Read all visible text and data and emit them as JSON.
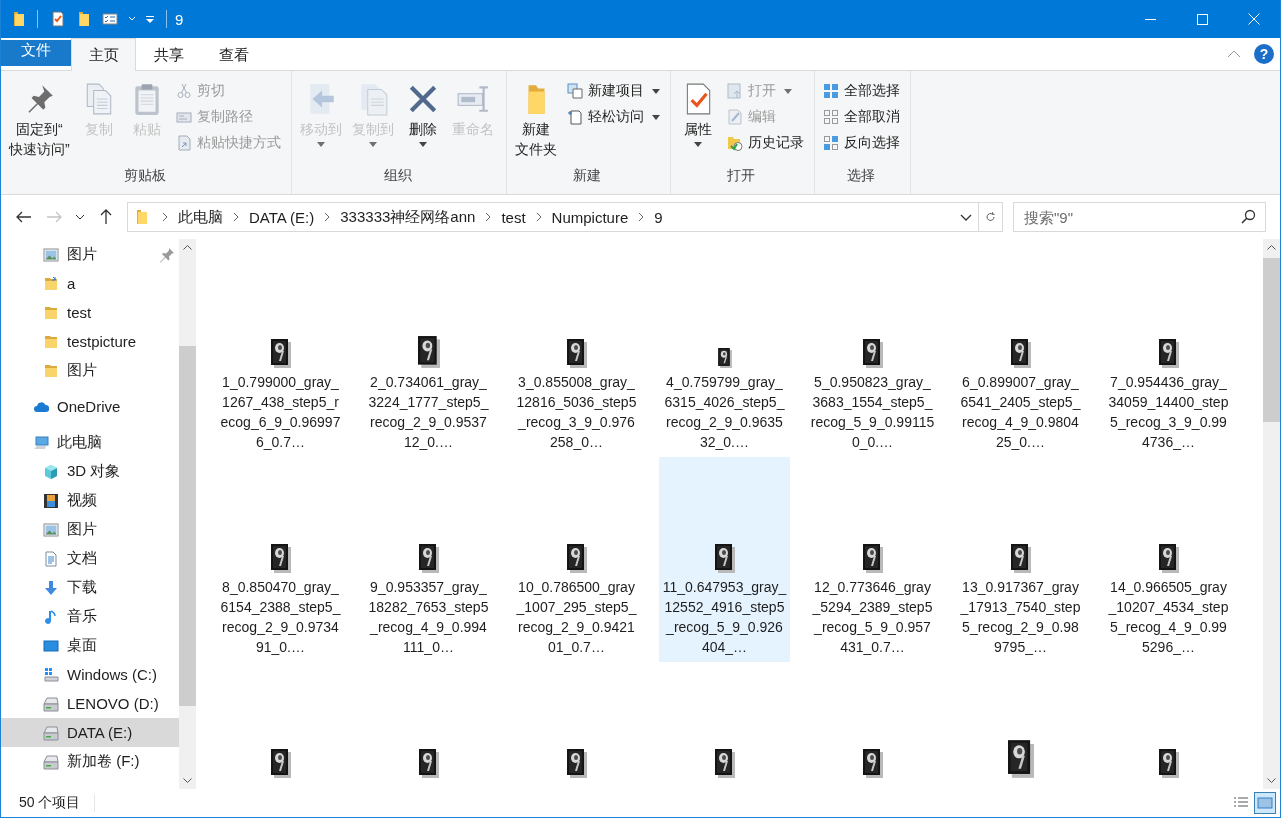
{
  "window": {
    "title": "9"
  },
  "ribbon_tabs": [
    {
      "label": "文件",
      "kind": "file",
      "selected": false
    },
    {
      "label": "主页",
      "kind": "tab",
      "selected": true
    },
    {
      "label": "共享",
      "kind": "tab",
      "selected": false
    },
    {
      "label": "查看",
      "kind": "tab",
      "selected": false
    }
  ],
  "help_button": {
    "label": "?"
  },
  "ribbon_groups": [
    {
      "title": "剪贴板",
      "items": [
        {
          "label_lines": [
            "固定到“",
            "快速访问”"
          ],
          "kind": "large",
          "disabled": false,
          "dropdown": false
        },
        {
          "label_lines": [
            "复制"
          ],
          "kind": "large",
          "disabled": true,
          "dropdown": false
        },
        {
          "label_lines": [
            "粘贴"
          ],
          "kind": "large",
          "disabled": true,
          "dropdown": false
        },
        {
          "label": "剪切",
          "kind": "small",
          "disabled": true,
          "dropdown": false
        },
        {
          "label": "复制路径",
          "kind": "small",
          "disabled": true,
          "dropdown": false
        },
        {
          "label": "粘贴快捷方式",
          "kind": "small",
          "disabled": true,
          "dropdown": false
        }
      ]
    },
    {
      "title": "组织",
      "items": [
        {
          "label_lines": [
            "移动到"
          ],
          "kind": "large",
          "disabled": true,
          "dropdown": true
        },
        {
          "label_lines": [
            "复制到"
          ],
          "kind": "large",
          "disabled": true,
          "dropdown": true
        },
        {
          "label_lines": [
            "删除"
          ],
          "kind": "large",
          "disabled": false,
          "dropdown": true
        },
        {
          "label_lines": [
            "重命名"
          ],
          "kind": "large",
          "disabled": true,
          "dropdown": false
        }
      ]
    },
    {
      "title": "新建",
      "items": [
        {
          "label_lines": [
            "新建",
            "文件夹"
          ],
          "kind": "large",
          "disabled": false,
          "dropdown": false
        },
        {
          "label": "新建项目",
          "kind": "small",
          "disabled": false,
          "dropdown": true
        },
        {
          "label": "轻松访问",
          "kind": "small",
          "disabled": false,
          "dropdown": true
        }
      ]
    },
    {
      "title": "打开",
      "items": [
        {
          "label_lines": [
            "属性"
          ],
          "kind": "large",
          "disabled": false,
          "dropdown": true
        },
        {
          "label": "打开",
          "kind": "small",
          "disabled": true,
          "dropdown": true
        },
        {
          "label": "编辑",
          "kind": "small",
          "disabled": true,
          "dropdown": false
        },
        {
          "label": "历史记录",
          "kind": "small",
          "disabled": false,
          "dropdown": false
        }
      ]
    },
    {
      "title": "选择",
      "items": [
        {
          "label": "全部选择",
          "kind": "small",
          "disabled": false,
          "dropdown": false
        },
        {
          "label": "全部取消",
          "kind": "small",
          "disabled": false,
          "dropdown": false
        },
        {
          "label": "反向选择",
          "kind": "small",
          "disabled": false,
          "dropdown": false
        }
      ]
    }
  ],
  "address_bar": {
    "forward_disabled": true,
    "segments": [
      "此电脑",
      "DATA (E:)",
      "333333神经网络ann",
      "test",
      "Numpicture",
      "9"
    ]
  },
  "search": {
    "placeholder": "搜索\"9\""
  },
  "sidebar": {
    "quick_access": [
      {
        "label": "图片",
        "pinned": true,
        "selected": false
      },
      {
        "label": "a",
        "pinned": false,
        "selected": false
      },
      {
        "label": "test",
        "pinned": false,
        "selected": false
      },
      {
        "label": "testpicture",
        "pinned": false,
        "selected": false
      },
      {
        "label": "图片",
        "pinned": false,
        "selected": false
      }
    ],
    "items": [
      {
        "label": "OneDrive",
        "selected": false
      },
      {
        "label": "此电脑",
        "selected": false,
        "children": [
          {
            "label": "3D 对象",
            "selected": false
          },
          {
            "label": "视频",
            "selected": false
          },
          {
            "label": "图片",
            "selected": false
          },
          {
            "label": "文档",
            "selected": false
          },
          {
            "label": "下载",
            "selected": false
          },
          {
            "label": "音乐",
            "selected": false
          },
          {
            "label": "桌面",
            "selected": false
          },
          {
            "label": "Windows (C:)",
            "selected": false
          },
          {
            "label": "LENOVO (D:)",
            "selected": false
          },
          {
            "label": "DATA (E:)",
            "selected": true
          },
          {
            "label": "新加卷 (F:)",
            "selected": false
          }
        ]
      }
    ]
  },
  "files": [
    {
      "label": "1_0.799000_gray_1267_438_step5_recog_6_9_0.969976_0.7…",
      "selected": false
    },
    {
      "label": "2_0.734061_gray_3224_1777_step5_recog_2_9_0.953712_0.…",
      "selected": false
    },
    {
      "label": "3_0.855008_gray_12816_5036_step5_recog_3_9_0.976258_0…",
      "selected": false
    },
    {
      "label": "4_0.759799_gray_6315_4026_step5_recog_2_9_0.963532_0.…",
      "selected": false
    },
    {
      "label": "5_0.950823_gray_3683_1554_step5_recog_5_9_0.991150_0.…",
      "selected": false
    },
    {
      "label": "6_0.899007_gray_6541_2405_step5_recog_4_9_0.980425_0.…",
      "selected": false
    },
    {
      "label": "7_0.954436_gray_34059_14400_step5_recog_3_9_0.994736_…",
      "selected": false
    },
    {
      "label": "8_0.850470_gray_6154_2388_step5_recog_2_9_0.973491_0.…",
      "selected": false
    },
    {
      "label": "9_0.953357_gray_18282_7653_step5_recog_4_9_0.994111_0…",
      "selected": false
    },
    {
      "label": "10_0.786500_gray_1007_295_step5_recog_2_9_0.942101_0.7…",
      "selected": false
    },
    {
      "label": "11_0.647953_gray_12552_4916_step5_recog_5_9_0.926404_…",
      "selected": true
    },
    {
      "label": "12_0.773646_gray_5294_2389_step5_recog_5_9_0.957431_0.7…",
      "selected": false
    },
    {
      "label": "13_0.917367_gray_17913_7540_step5_recog_2_9_0.989795_…",
      "selected": false
    },
    {
      "label": "14_0.966505_gray_10207_4534_step5_recog_4_9_0.995296_…",
      "selected": false
    },
    {
      "selected": false
    },
    {
      "selected": false
    },
    {
      "selected": false
    },
    {
      "selected": false
    },
    {
      "selected": false
    },
    {
      "selected": false
    },
    {
      "selected": false
    }
  ],
  "status_bar": {
    "item_count": "50 个项目",
    "views": [
      {
        "kind": "details",
        "selected": false
      },
      {
        "kind": "large_icons",
        "selected": true
      }
    ]
  }
}
